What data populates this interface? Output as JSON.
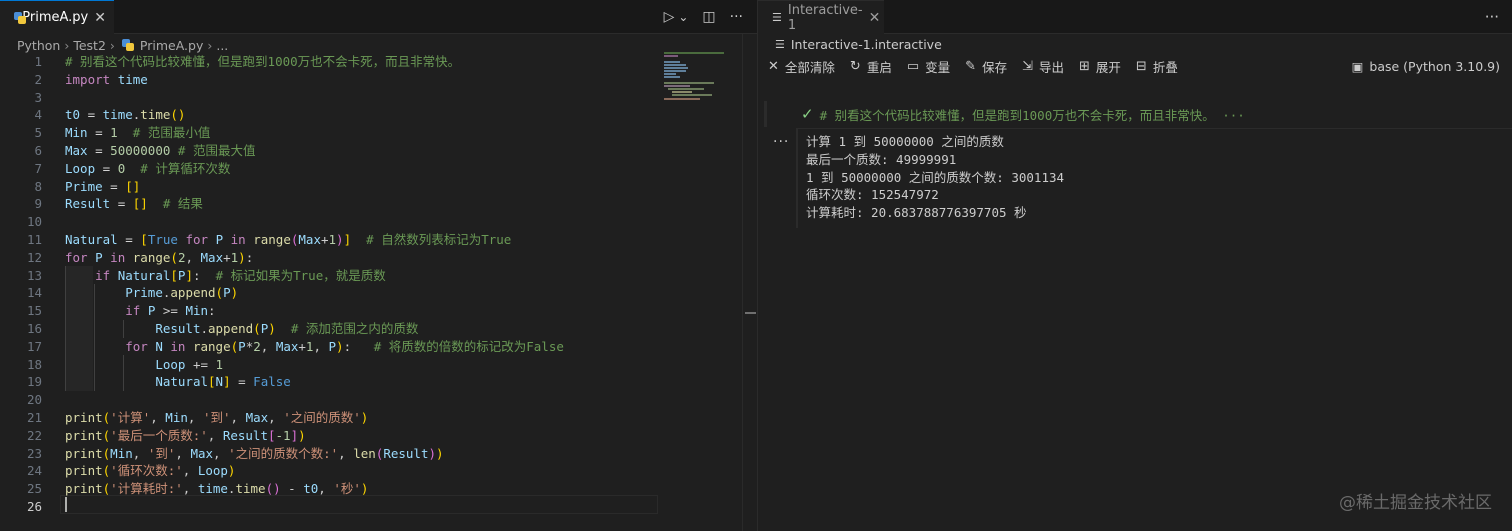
{
  "editor_tab": {
    "label": "PrimeA.py",
    "close": "✕"
  },
  "editor_actions": {
    "run": "▷",
    "run_menu": "⌄",
    "split": "◫",
    "more": "···"
  },
  "breadcrumb": {
    "parts": [
      "Python",
      "Test2",
      "PrimeA.py",
      "..."
    ]
  },
  "line_numbers": [
    "1",
    "2",
    "3",
    "4",
    "5",
    "6",
    "7",
    "8",
    "9",
    "10",
    "11",
    "12",
    "13",
    "14",
    "15",
    "16",
    "17",
    "18",
    "19",
    "20",
    "21",
    "22",
    "23",
    "24",
    "25",
    "26"
  ],
  "code": {
    "l1": "# 别看这个代码比较难懂，但是跑到1000万也不会卡死，而且非常快。",
    "l2_kw": "import",
    "l2_mod": "time",
    "l4_a": "t0",
    "l4_b": "time",
    "l4_c": "time",
    "l5_a": "Min",
    "l5_num": "1",
    "l5_cm": "# 范围最小值",
    "l6_a": "Max",
    "l6_num": "50000000",
    "l6_cm": "# 范围最大值",
    "l7_a": "Loop",
    "l7_num": "0",
    "l7_cm": "# 计算循环次数",
    "l8_a": "Prime",
    "l9_a": "Result",
    "l9_cm": "# 结果",
    "l11_a": "Natural",
    "l11_true": "True",
    "l11_for": "for",
    "l11_p": "P",
    "l11_in": "in",
    "l11_range": "range",
    "l11_max": "Max",
    "l11_num": "1",
    "l11_cm": "# 自然数列表标记为True",
    "l12_for": "for",
    "l12_p": "P",
    "l12_in": "in",
    "l12_range": "range",
    "l12_n2": "2",
    "l12_max": "Max",
    "l12_n1": "1",
    "l13_if": "if",
    "l13_nat": "Natural",
    "l13_p": "P",
    "l13_cm": "# 标记如果为True，就是质数",
    "l14_prime": "Prime",
    "l14_fn": "append",
    "l14_p": "P",
    "l15_if": "if",
    "l15_p": "P",
    "l15_min": "Min",
    "l16_res": "Result",
    "l16_fn": "append",
    "l16_p": "P",
    "l16_cm": "# 添加范围之内的质数",
    "l17_for": "for",
    "l17_n": "N",
    "l17_in": "in",
    "l17_range": "range",
    "l17_p": "P",
    "l17_2": "2",
    "l17_max": "Max",
    "l17_1": "1",
    "l17_p2": "P",
    "l17_cm": "# 将质数的倍数的标记改为False",
    "l18_loop": "Loop",
    "l18_num": "1",
    "l19_nat": "Natural",
    "l19_n": "N",
    "l19_false": "False",
    "l21_print": "print",
    "l21_s1": "'计算'",
    "l21_min": "Min",
    "l21_s2": "'到'",
    "l21_max": "Max",
    "l21_s3": "'之间的质数'",
    "l22_print": "print",
    "l22_s1": "'最后一个质数:'",
    "l22_res": "Result",
    "l22_num": "-1",
    "l23_print": "print",
    "l23_min": "Min",
    "l23_s1": "'到'",
    "l23_max": "Max",
    "l23_s2": "'之间的质数个数:'",
    "l23_len": "len",
    "l23_res": "Result",
    "l24_print": "print",
    "l24_s1": "'循环次数:'",
    "l24_loop": "Loop",
    "l25_print": "print",
    "l25_s1": "'计算耗时:'",
    "l25_time": "time",
    "l25_t": "time",
    "l25_t0": "t0",
    "l25_s2": "'秒'"
  },
  "interactive_tab": {
    "label": "Interactive-1",
    "close": "✕"
  },
  "interactive_actions": {
    "more": "···"
  },
  "interactive_breadcrumb": {
    "label": "Interactive-1.interactive"
  },
  "toolbar": {
    "clear_all": "全部清除",
    "restart": "重启",
    "variables": "变量",
    "save": "保存",
    "export": "导出",
    "expand": "展开",
    "collapse": "折叠"
  },
  "kernel": {
    "label": "base (Python 3.10.9)"
  },
  "cell": {
    "input_summary": "# 别看这个代码比较难懂，但是跑到1000万也不会卡死，而且非常快。 ···",
    "more_dots": "···",
    "output_lines": [
      "计算 1 到 50000000 之间的质数",
      "最后一个质数: 49999991",
      "1 到 50000000 之间的质数个数: 3001134",
      "循环次数: 152547972",
      "计算耗时: 20.683788776397705 秒"
    ]
  },
  "watermark": {
    "text": "@稀土掘金技术社区"
  }
}
